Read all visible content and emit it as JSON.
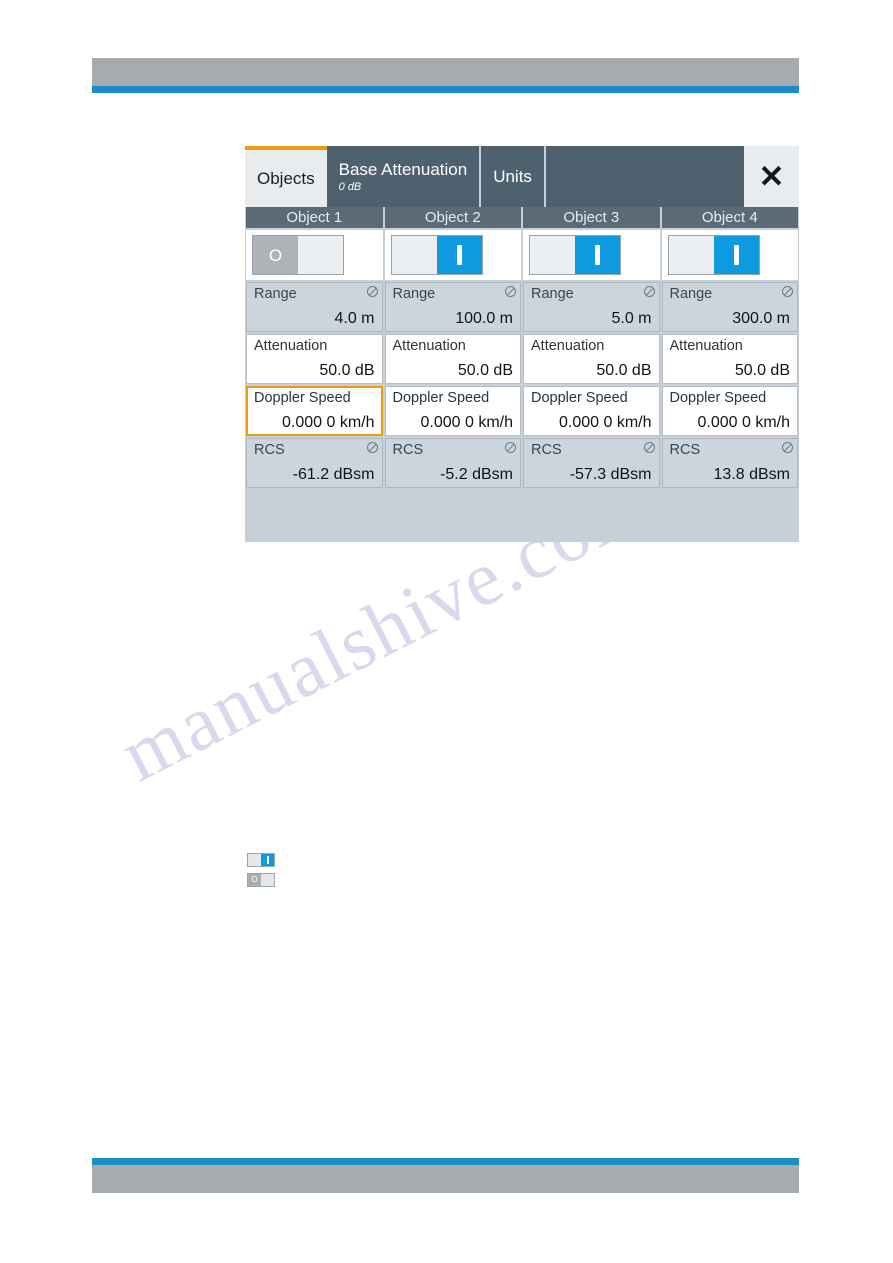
{
  "page": {
    "watermark": "manualshive.com"
  },
  "dialog": {
    "tabs": [
      {
        "title": "Objects",
        "subtitle": "",
        "active": true
      },
      {
        "title": "Base Attenuation",
        "subtitle": "0 dB",
        "active": false
      },
      {
        "title": "Units",
        "subtitle": "",
        "active": false
      }
    ],
    "close_icon": "close-icon",
    "close_glyph": "✕",
    "row_labels": {
      "range": "Range",
      "attenuation": "Attenuation",
      "doppler_speed": "Doppler Speed",
      "rcs": "RCS"
    },
    "toggle_glyphs": {
      "on": "|",
      "off": "O"
    },
    "columns": [
      {
        "header": "Object 1",
        "state": "off",
        "range": "4.0 m",
        "attenuation": "50.0 dB",
        "doppler_speed": "0.000 0 km/h",
        "rcs": "-61.2 dBsm",
        "focused_field": "doppler_speed"
      },
      {
        "header": "Object 2",
        "state": "on",
        "range": "100.0 m",
        "attenuation": "50.0 dB",
        "doppler_speed": "0.000 0 km/h",
        "rcs": "-5.2 dBsm",
        "focused_field": ""
      },
      {
        "header": "Object 3",
        "state": "on",
        "range": "5.0 m",
        "attenuation": "50.0 dB",
        "doppler_speed": "0.000 0 km/h",
        "rcs": "-57.3 dBsm",
        "focused_field": ""
      },
      {
        "header": "Object 4",
        "state": "on",
        "range": "300.0 m",
        "attenuation": "50.0 dB",
        "doppler_speed": "0.000 0 km/h",
        "rcs": "13.8 dBsm",
        "focused_field": ""
      }
    ]
  },
  "legend": {
    "items": [
      {
        "state": "on",
        "glyph": "|"
      },
      {
        "state": "off",
        "glyph": "O"
      }
    ]
  },
  "colors": {
    "accent_blue": "#1a8cc8",
    "toggle_on": "#0d9ae0",
    "focus_orange": "#ef9b10",
    "tab_bar": "#4e616e",
    "column_header": "#5a6b77",
    "panel_bg": "#c7cfd8",
    "rule_gray": "#a6abaf"
  }
}
